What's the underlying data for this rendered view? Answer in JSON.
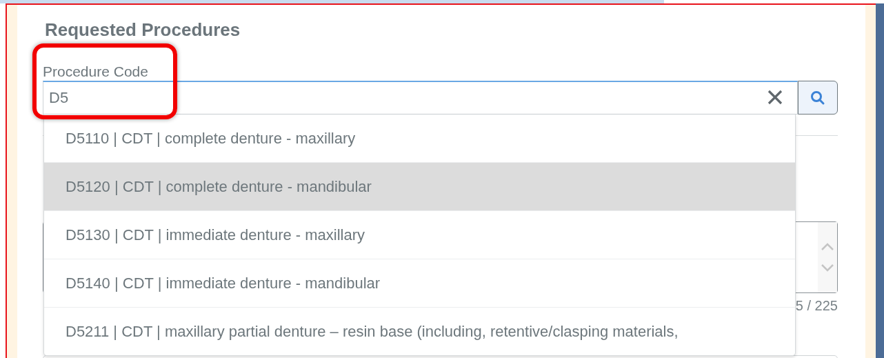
{
  "section": {
    "title": "Requested Procedures"
  },
  "procedure_code": {
    "label": "Procedure Code",
    "value": "D5",
    "highlighted": true
  },
  "suggestions": [
    {
      "text": "D5110 | CDT | complete denture - maxillary",
      "selected": false
    },
    {
      "text": "D5120 | CDT | complete denture - mandibular",
      "selected": true
    },
    {
      "text": "D5130 | CDT | immediate denture - maxillary",
      "selected": false
    },
    {
      "text": "D5140 | CDT | immediate denture - mandibular",
      "selected": false
    },
    {
      "text": "D5211 | CDT | maxillary partial denture – resin base (including, retentive/clasping materials,",
      "selected": false
    }
  ],
  "notes_counter": "5 / 225"
}
